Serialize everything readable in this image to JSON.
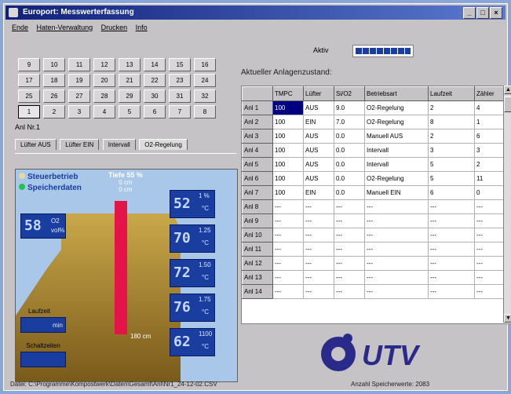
{
  "window": {
    "title": "Europort: Messwerterfassung"
  },
  "menu": [
    "Ende",
    "Haten-Verwaltung",
    "Drucken",
    "Info"
  ],
  "calendar": {
    "rows": [
      [
        "9",
        "10",
        "11",
        "12",
        "13",
        "14",
        "15",
        "16"
      ],
      [
        "17",
        "18",
        "19",
        "20",
        "21",
        "22",
        "23",
        "24"
      ],
      [
        "25",
        "26",
        "27",
        "28",
        "29",
        "30",
        "31",
        "32"
      ],
      [
        "1",
        "2",
        "3",
        "4",
        "5",
        "6",
        "7",
        "8"
      ]
    ],
    "selected_label": "Anl Nr.1"
  },
  "tabs": [
    "Lüfter AUS",
    "Lüfter EIN",
    "Intervall",
    "O2-Regelung"
  ],
  "scene": {
    "legend_1": "Steuerbetrieb",
    "legend_2": "Speicherdaten",
    "depth_title": "Tiefe 55 %",
    "depth_sub1": "0 cm",
    "depth_sub2": "0 cm",
    "rod_bottom": "180 cm",
    "o2_value": "58",
    "o2_label": "O2",
    "o2_unit": "vol%",
    "temps": [
      {
        "value": "52",
        "depth": "1 %",
        "unit": "°C"
      },
      {
        "value": "70",
        "depth": "1.25",
        "unit": "°C"
      },
      {
        "value": "72",
        "depth": "1.50",
        "unit": "°C"
      },
      {
        "value": "76",
        "depth": "1.75",
        "unit": "°C"
      },
      {
        "value": "62",
        "depth": "1100",
        "unit": "°C"
      }
    ],
    "box1_label": "Laufzeit",
    "box1_unit": "min",
    "box2_label": "Schaltzeiten"
  },
  "aktiv": {
    "label": "Aktiv"
  },
  "table": {
    "heading": "Aktueller Anlagenzustand:",
    "columns": [
      "",
      "TMPC",
      "Lüfter",
      "Si/O2",
      "Betriebsart",
      "Laufzeit",
      "Zähler"
    ],
    "rows": [
      [
        "Anl 1",
        "100",
        "AUS",
        "9.0",
        "O2-Regelung",
        "2",
        "4"
      ],
      [
        "Anl 2",
        "100",
        "EIN",
        "7.0",
        "O2-Regelung",
        "8",
        "1"
      ],
      [
        "Anl 3",
        "100",
        "AUS",
        "0.0",
        "Manuell AUS",
        "2",
        "6"
      ],
      [
        "Anl 4",
        "100",
        "AUS",
        "0.0",
        "Intervall",
        "3",
        "3"
      ],
      [
        "Anl 5",
        "100",
        "AUS",
        "0.0",
        "Intervall",
        "5",
        "2"
      ],
      [
        "Anl 6",
        "100",
        "AUS",
        "0.0",
        "O2-Regelung",
        "5",
        "11"
      ],
      [
        "Anl 7",
        "100",
        "EIN",
        "0.0",
        "Manuell EIN",
        "6",
        "0"
      ],
      [
        "Anl 8",
        "---",
        "---",
        "---",
        "---",
        "---",
        "---"
      ],
      [
        "Anl 9",
        "---",
        "---",
        "---",
        "---",
        "---",
        "---"
      ],
      [
        "Anl 10",
        "---",
        "---",
        "---",
        "---",
        "---",
        "---"
      ],
      [
        "Anl 11",
        "---",
        "---",
        "---",
        "---",
        "---",
        "---"
      ],
      [
        "Anl 12",
        "---",
        "---",
        "---",
        "---",
        "---",
        "---"
      ],
      [
        "Anl 13",
        "---",
        "---",
        "---",
        "---",
        "---",
        "---"
      ],
      [
        "Anl 14",
        "---",
        "---",
        "---",
        "---",
        "---",
        "---"
      ]
    ]
  },
  "logo": {
    "text": "UTV"
  },
  "statusbar": {
    "left": "Datei: C:\\Programme\\Kompostwerk\\Daten\\Gesamt\\Anl\\Nr1_24-12-02.CSV",
    "right": "Anzahl Speicherwerte: 2083"
  },
  "colors": {
    "lcd": "#1a3da0",
    "rod": "#e4144a",
    "title_bar": "#10207a",
    "sand": "#c9a84a"
  }
}
